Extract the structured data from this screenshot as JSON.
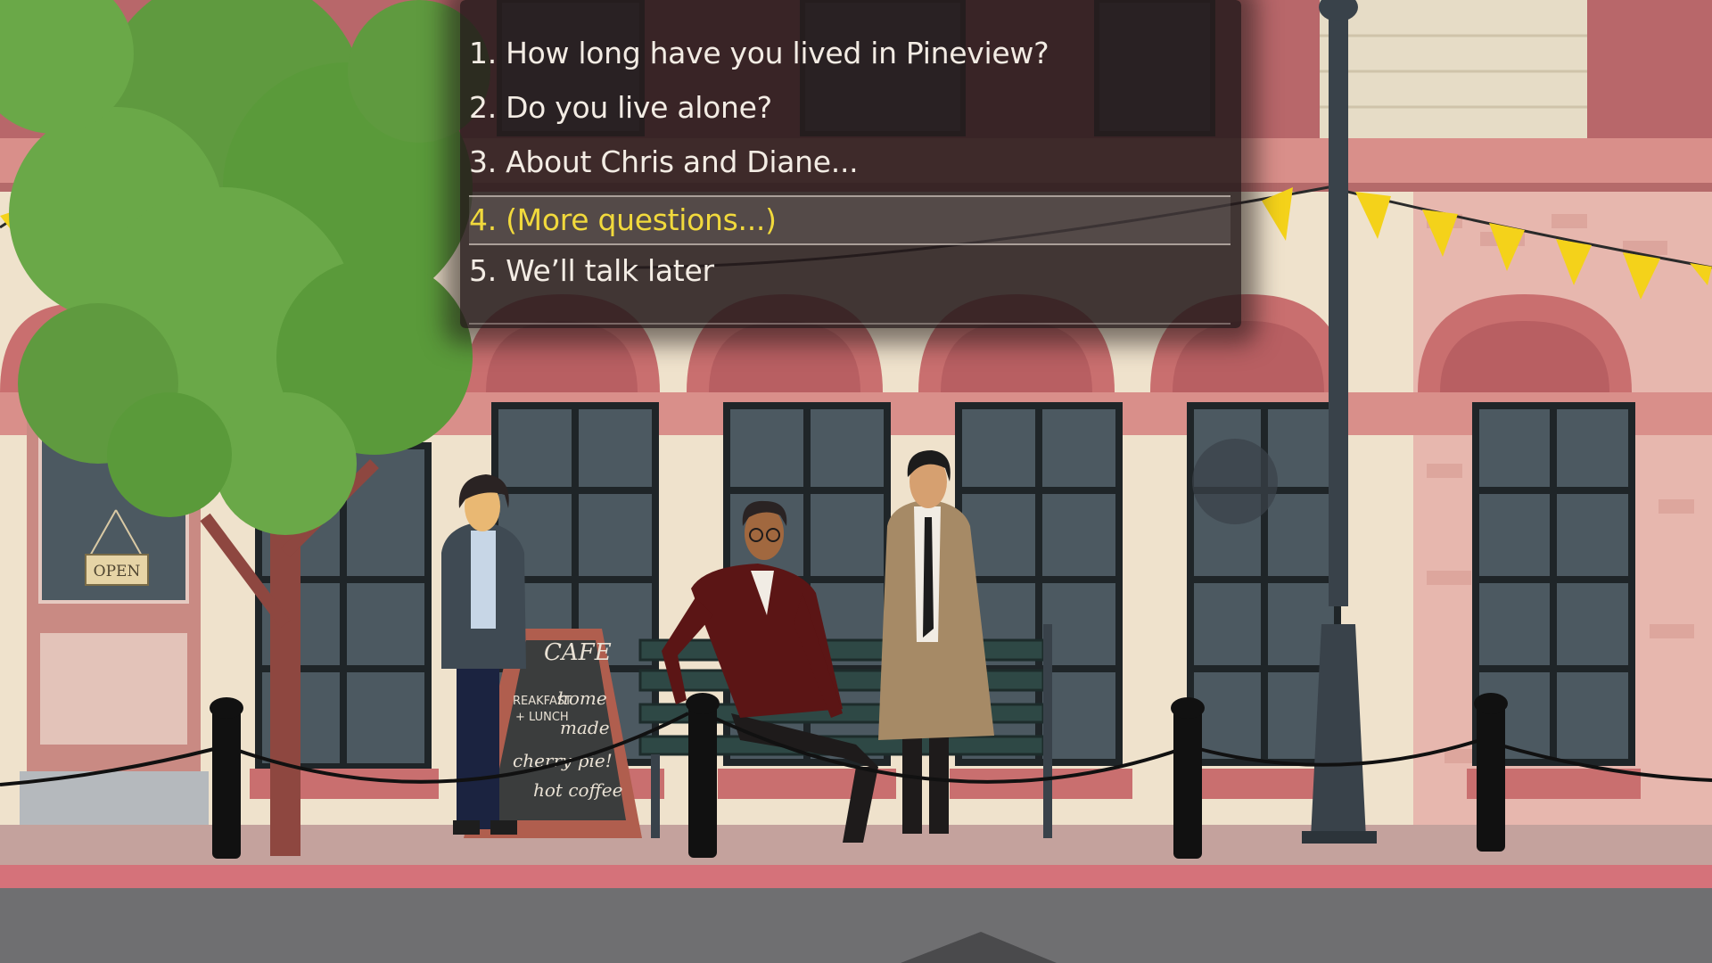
{
  "dialogue": {
    "options": [
      {
        "label": "1. How long have you lived in Pineview?"
      },
      {
        "label": "2. Do you live alone?"
      },
      {
        "label": "3. About Chris and Diane..."
      },
      {
        "label": "4. (More questions...)",
        "selected": true
      },
      {
        "label": "5. We’ll talk later"
      }
    ]
  },
  "scene": {
    "door_sign": "OPEN",
    "cafe_board": {
      "title": "CAFE",
      "left_lines": [
        "REAKFAST",
        "+ LUNCH"
      ],
      "right_lines": [
        "home",
        "made",
        "cherry pie!",
        "hot coffee"
      ]
    }
  },
  "colors": {
    "highlight_text": "#f1d93c",
    "option_text": "#f3ece4",
    "brick_red": "#c96f6f",
    "pennant_yellow": "#f4d21a"
  }
}
